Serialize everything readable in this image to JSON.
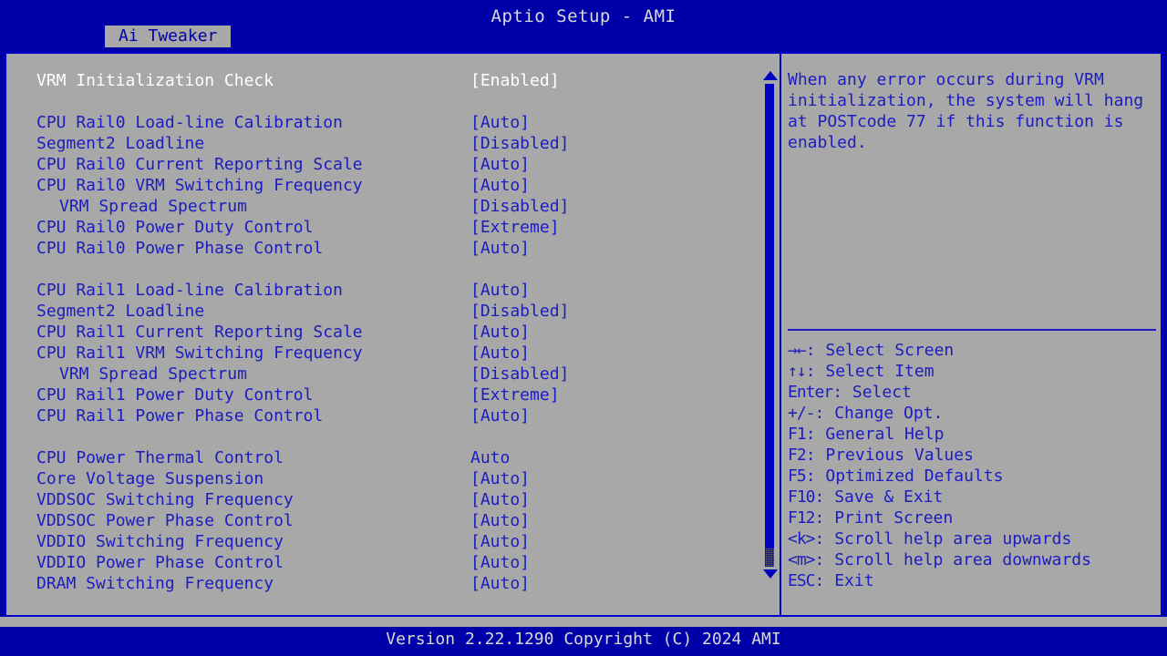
{
  "window": {
    "title": "Aptio Setup - AMI",
    "bg_color": "#0000a8",
    "panel_color": "#a8a8a8",
    "text_color": "#1c1cc0",
    "selected_text_color": "#ffffff"
  },
  "tabs": [
    {
      "label": "Ai Tweaker",
      "active": true
    }
  ],
  "settings": [
    {
      "label": "VRM Initialization Check",
      "value": "[Enabled]",
      "indent": false,
      "selected": true,
      "spacer_after": true
    },
    {
      "label": "CPU Rail0 Load-line Calibration",
      "value": "[Auto]",
      "indent": false,
      "selected": false,
      "spacer_after": false
    },
    {
      "label": "Segment2 Loadline",
      "value": "[Disabled]",
      "indent": false,
      "selected": false,
      "spacer_after": false
    },
    {
      "label": "CPU Rail0 Current Reporting Scale",
      "value": "[Auto]",
      "indent": false,
      "selected": false,
      "spacer_after": false
    },
    {
      "label": "CPU Rail0 VRM Switching Frequency",
      "value": "[Auto]",
      "indent": false,
      "selected": false,
      "spacer_after": false
    },
    {
      "label": "VRM Spread Spectrum",
      "value": "[Disabled]",
      "indent": true,
      "selected": false,
      "spacer_after": false
    },
    {
      "label": "CPU Rail0 Power Duty Control",
      "value": "[Extreme]",
      "indent": false,
      "selected": false,
      "spacer_after": false
    },
    {
      "label": "CPU Rail0 Power Phase Control",
      "value": "[Auto]",
      "indent": false,
      "selected": false,
      "spacer_after": true
    },
    {
      "label": "CPU Rail1 Load-line Calibration",
      "value": "[Auto]",
      "indent": false,
      "selected": false,
      "spacer_after": false
    },
    {
      "label": "Segment2 Loadline",
      "value": "[Disabled]",
      "indent": false,
      "selected": false,
      "spacer_after": false
    },
    {
      "label": "CPU Rail1 Current Reporting Scale",
      "value": "[Auto]",
      "indent": false,
      "selected": false,
      "spacer_after": false
    },
    {
      "label": "CPU Rail1 VRM Switching Frequency",
      "value": "[Auto]",
      "indent": false,
      "selected": false,
      "spacer_after": false
    },
    {
      "label": "VRM Spread Spectrum",
      "value": "[Disabled]",
      "indent": true,
      "selected": false,
      "spacer_after": false
    },
    {
      "label": "CPU Rail1 Power Duty Control",
      "value": "[Extreme]",
      "indent": false,
      "selected": false,
      "spacer_after": false
    },
    {
      "label": "CPU Rail1 Power Phase Control",
      "value": "[Auto]",
      "indent": false,
      "selected": false,
      "spacer_after": true
    },
    {
      "label": "CPU Power Thermal Control",
      "value": "Auto",
      "indent": false,
      "selected": false,
      "spacer_after": false
    },
    {
      "label": "Core Voltage Suspension",
      "value": "[Auto]",
      "indent": false,
      "selected": false,
      "spacer_after": false
    },
    {
      "label": "VDDSOC Switching Frequency",
      "value": "[Auto]",
      "indent": false,
      "selected": false,
      "spacer_after": false
    },
    {
      "label": "VDDSOC Power Phase Control",
      "value": "[Auto]",
      "indent": false,
      "selected": false,
      "spacer_after": false
    },
    {
      "label": "VDDIO Switching Frequency",
      "value": "[Auto]",
      "indent": false,
      "selected": false,
      "spacer_after": false
    },
    {
      "label": "VDDIO Power Phase Control",
      "value": "[Auto]",
      "indent": false,
      "selected": false,
      "spacer_after": false
    },
    {
      "label": "DRAM Switching Frequency",
      "value": "[Auto]",
      "indent": false,
      "selected": false,
      "spacer_after": false
    }
  ],
  "scrollbar": {
    "up_arrow": "scroll-up-arrow",
    "down_arrow": "scroll-down-arrow"
  },
  "help": {
    "description": "When any error occurs during VRM initialization, the system will hang at POSTcode 77 if this function is enabled.",
    "legend": [
      {
        "key": "→←",
        "text": ": Select Screen"
      },
      {
        "key": "↑↓",
        "text": ": Select Item"
      },
      {
        "key": "Enter",
        "text": ": Select"
      },
      {
        "key": "+/-",
        "text": ": Change Opt."
      },
      {
        "key": "F1",
        "text": ": General Help"
      },
      {
        "key": "F2",
        "text": ": Previous Values"
      },
      {
        "key": "F5",
        "text": ": Optimized Defaults"
      },
      {
        "key": "F10",
        "text": ": Save & Exit"
      },
      {
        "key": "F12",
        "text": ": Print Screen"
      },
      {
        "key": "<k>",
        "text": ": Scroll help area upwards"
      },
      {
        "key": "<m>",
        "text": ": Scroll help area downwards"
      },
      {
        "key": "ESC",
        "text": ": Exit"
      }
    ]
  },
  "footer": {
    "version_text": "Version 2.22.1290 Copyright (C) 2024 AMI"
  }
}
